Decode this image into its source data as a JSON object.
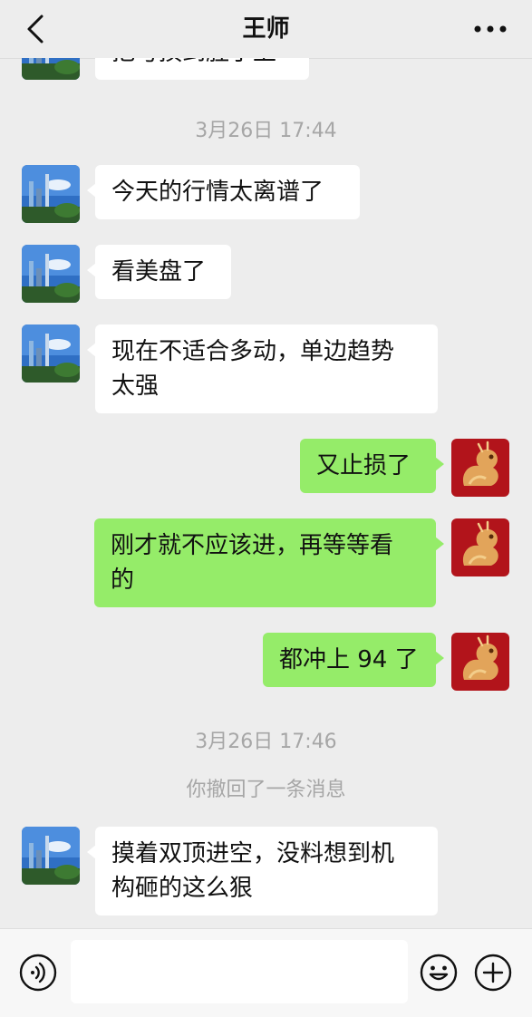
{
  "header": {
    "title": "王师"
  },
  "messages": {
    "partial_top": "把亏损到胜了上",
    "timestamp_1": "3月26日 17:44",
    "m1": "今天的行情太离谱了",
    "m2": "看美盘了",
    "m3_line1": "现在不适合多动，单边趋势",
    "m3_line2": "太强",
    "m4": "又止损了",
    "m5_line1": "刚才就不应该进，再等等看",
    "m5_line2": "的",
    "m6": "都冲上 94 了",
    "timestamp_2": "3月26日 17:46",
    "recall_notice": "你撤回了一条消息",
    "m7_line1": "摸着双顶进空，没料想到机",
    "m7_line2": "构砸的这么狠"
  },
  "input": {
    "placeholder": ""
  },
  "colors": {
    "background": "#ededed",
    "incoming_bubble": "#ffffff",
    "outgoing_bubble": "#95ec69"
  },
  "icons": {
    "back": "chevron-left-icon",
    "more": "more-dots-icon",
    "voice": "voice-icon",
    "emoji": "emoji-icon",
    "plus": "plus-icon"
  }
}
